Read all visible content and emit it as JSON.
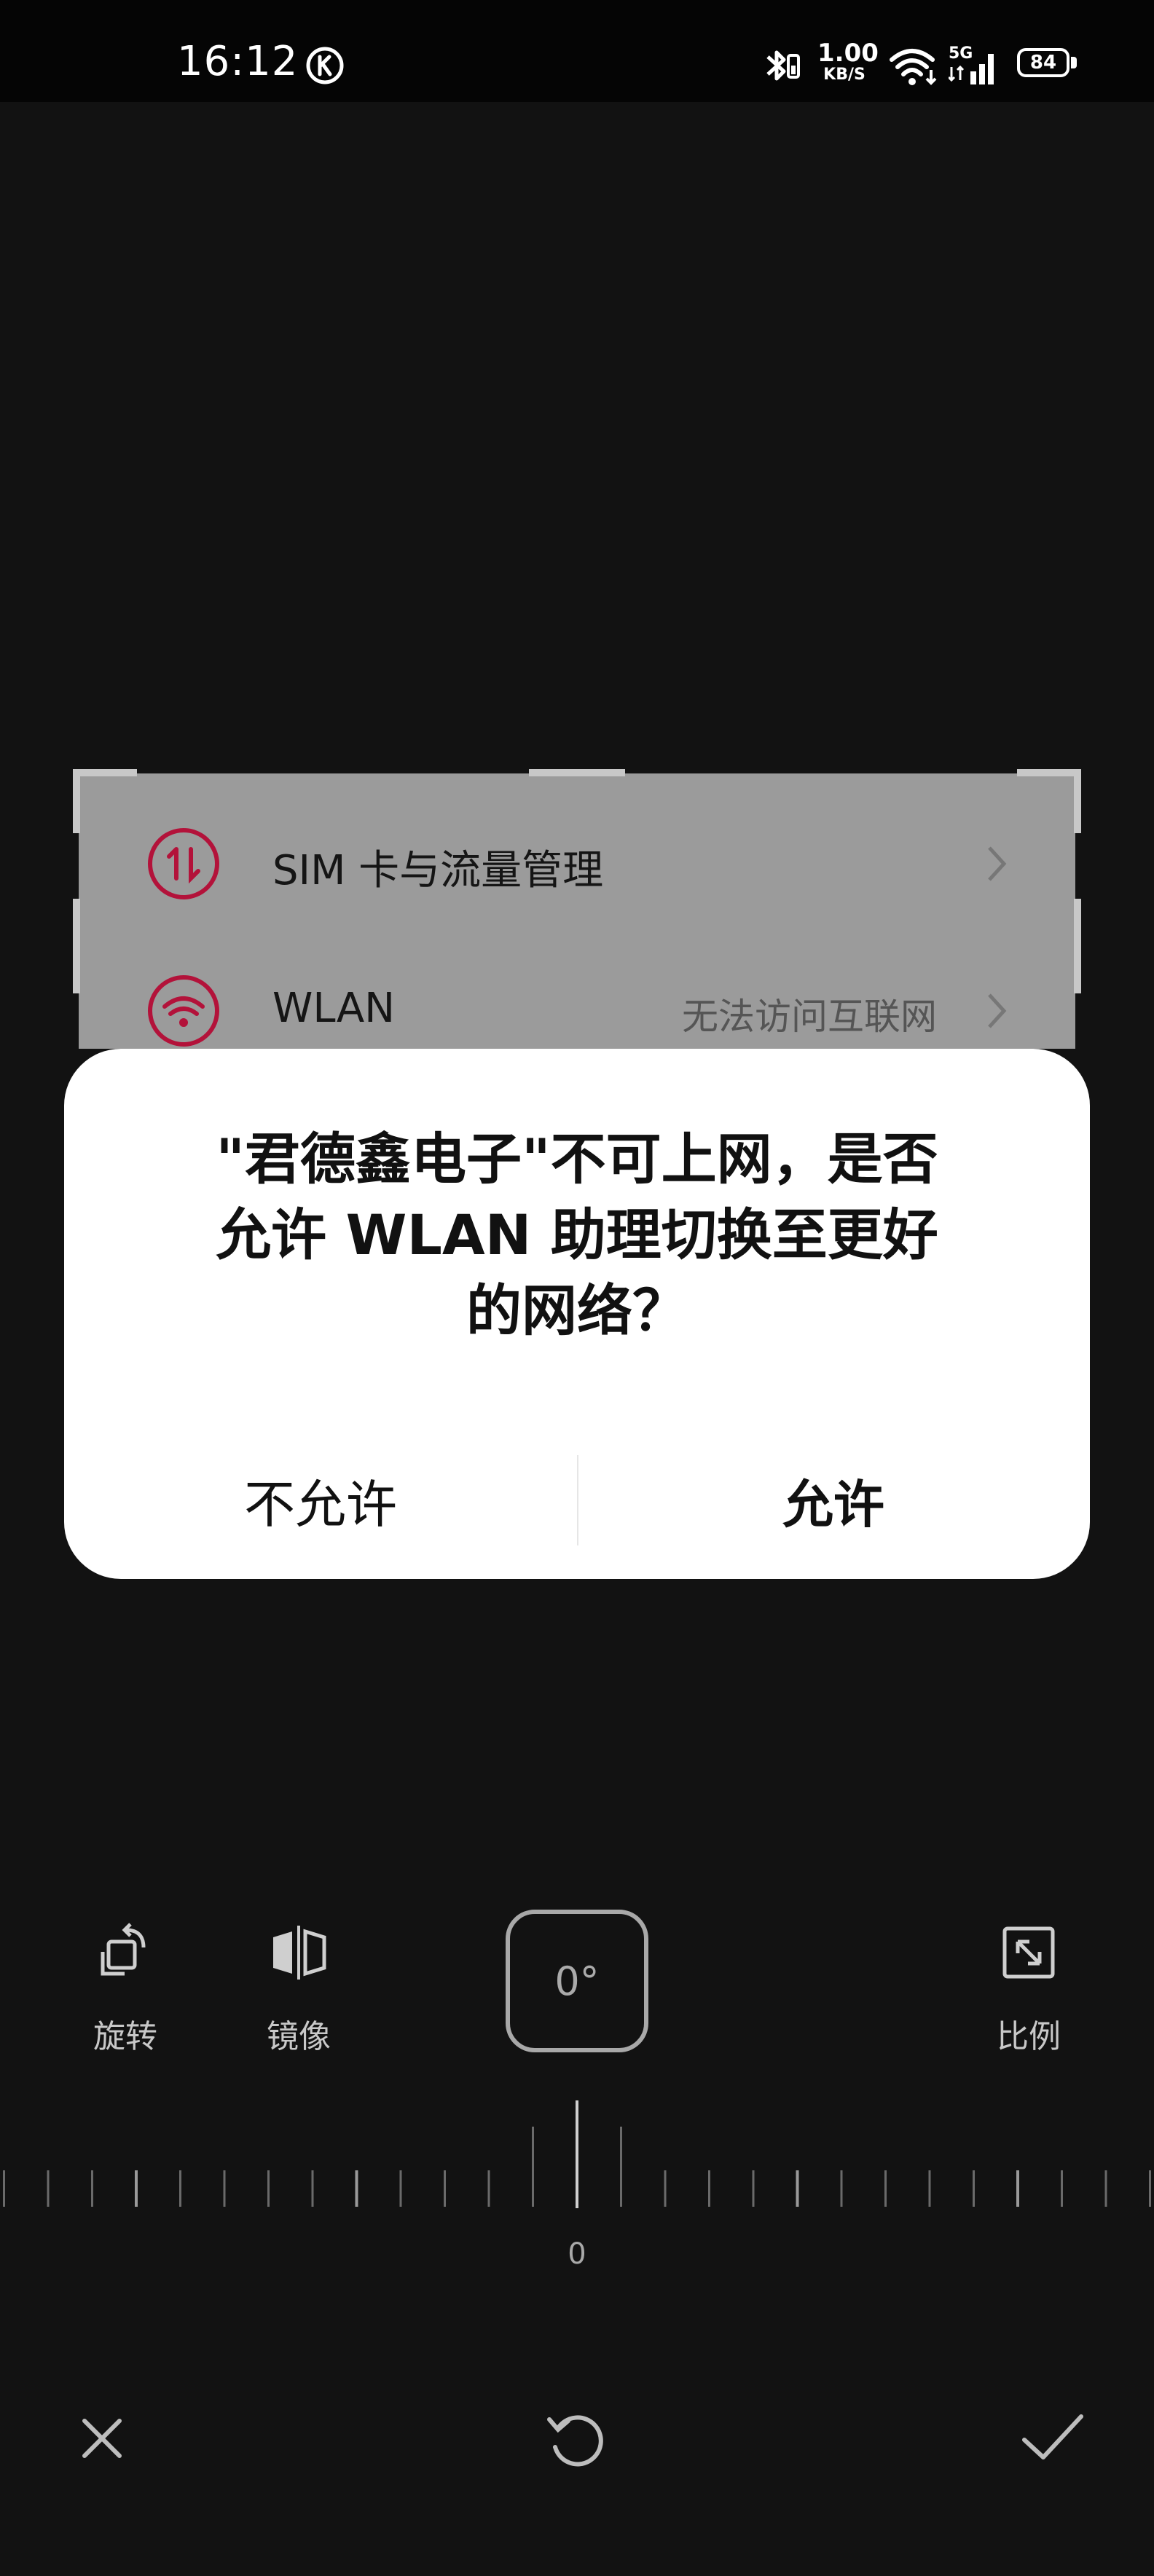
{
  "status_bar": {
    "time": "16:12",
    "speed_value": "1.00",
    "speed_unit": "KB/S",
    "network": "5G",
    "battery": "84"
  },
  "preview": {
    "rows": [
      {
        "label": "SIM 卡与流量管理",
        "value": "",
        "icon": "sim-data-icon"
      },
      {
        "label": "WLAN",
        "value": "无法访问互联网",
        "icon": "wifi-icon"
      }
    ]
  },
  "dialog": {
    "title": "\"君德鑫电子\"不可上网，是否允许 WLAN 助理切换至更好的网络？",
    "deny": "不允许",
    "allow": "允许"
  },
  "tools": {
    "rotate": "旋转",
    "mirror": "镜像",
    "angle": "0°",
    "ratio": "比例",
    "ruler_zero": "0"
  },
  "colors": {
    "accent_red": "#b3123a",
    "dialog_bg": "#ffffff",
    "background": "#121212"
  }
}
